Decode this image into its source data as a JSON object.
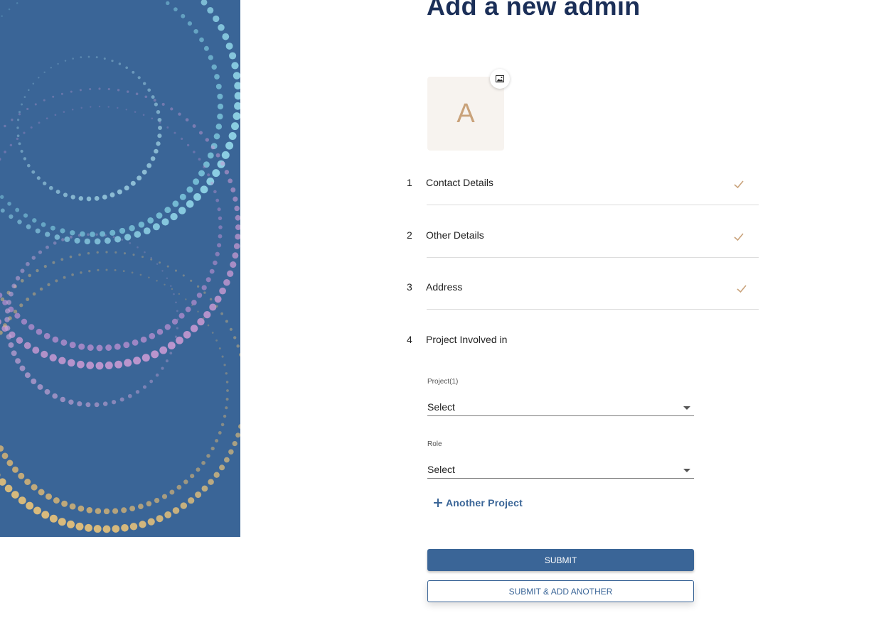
{
  "page": {
    "title": "Add a new admin"
  },
  "avatar": {
    "initial": "A",
    "upload_icon": "image-icon"
  },
  "steps": [
    {
      "number": "1",
      "label": "Contact Details",
      "completed": true
    },
    {
      "number": "2",
      "label": "Other Details",
      "completed": true
    },
    {
      "number": "3",
      "label": "Address",
      "completed": true
    },
    {
      "number": "4",
      "label": "Project Involved in",
      "completed": false
    }
  ],
  "project_form": {
    "project_label": "Project(1)",
    "project_value": "Select",
    "role_label": "Role",
    "role_value": "Select",
    "add_project_label": "Another Project"
  },
  "actions": {
    "submit_label": "SUBMIT",
    "submit_add_another_label": "SUBMIT & ADD ANOTHER"
  },
  "colors": {
    "brand": "#3a6597",
    "title": "#1b2f58",
    "check": "#c9a27a"
  }
}
